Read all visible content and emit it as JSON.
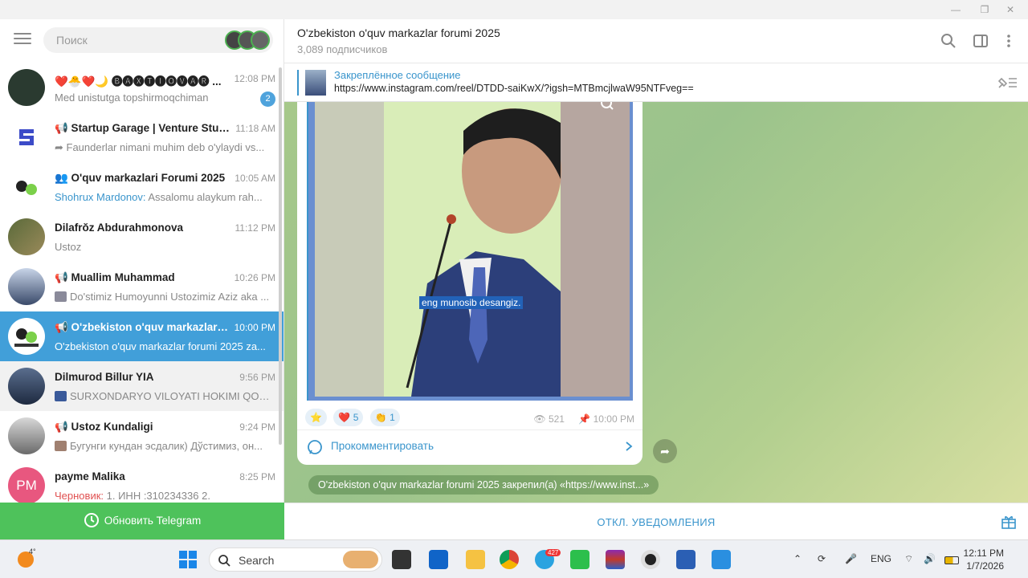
{
  "window": {
    "minimize": "—",
    "maximize": "❐",
    "close": "✕"
  },
  "sidebar": {
    "search_placeholder": "Поиск",
    "chats": [
      {
        "name": "❤️🐣❤️🌙 🅑🅐🅧🅣🅘🅞🅥🅐🅡 ...",
        "time": "12:08 PM",
        "preview": "Med unistutga topshirmoqchiman",
        "unread": "2"
      },
      {
        "name": "📢 Startup Garage | Venture Studi...",
        "time": "11:18 AM",
        "preview": "➦ Faunderlar nimani muhim deb o'ylaydi vs..."
      },
      {
        "name": "👥 O'quv markazlari Forumi 2025",
        "time": "10:05 AM",
        "sender": "Shohrux Mardonov:",
        "preview": " Assalomu alaykum rah..."
      },
      {
        "name": "Dilafrŏz Abdurahmonova",
        "time": "11:12 PM",
        "preview": "Ustoz"
      },
      {
        "name": "📢 Muallim Muhammad",
        "time": "10:26 PM",
        "preview": "Do'stimiz Humoyunni Ustozimiz Aziz aka ..."
      },
      {
        "name": "📢 O'zbekiston o'quv markazlar fo...",
        "time": "10:00 PM",
        "preview": "O'zbekiston o'quv markazlar forumi 2025 za..."
      },
      {
        "name": "Dilmurod Billur YIA",
        "time": "9:56 PM",
        "preview": "SURXONDARYO VILOYATI HOKIMI QOSIM..."
      },
      {
        "name": "📢 Ustoz Kundaligi",
        "time": "9:24 PM",
        "preview": "Бугунги кундан эсдалик)  Дўстимиз, он..."
      },
      {
        "name": "payme Malika",
        "time": "8:25 PM",
        "draft": "Черновик:",
        "preview": " 1. ИНН :310234336 2.",
        "initials": "PM"
      }
    ],
    "update_label": "Обновить Telegram"
  },
  "header": {
    "title": "O'zbekiston o'quv markazlar forumi 2025",
    "subscribers": "3,089 подписчиков"
  },
  "pinned": {
    "title": "Закреплённое сообщение",
    "text": "https://www.instagram.com/reel/DTDD-saiKwX/?igsh=MTBmcjlwaW95NTFveg=="
  },
  "post": {
    "caption": "eng munosib desangiz.",
    "reactions": [
      {
        "emoji": "⭐",
        "count": ""
      },
      {
        "emoji": "❤️",
        "count": "5"
      },
      {
        "emoji": "👏",
        "count": "1"
      }
    ],
    "views": "521",
    "time": "10:00 PM",
    "comment_label": "Прокомментировать"
  },
  "system_message": "O'zbekiston o'quv markazlar forumi 2025 закрепил(а) «https://www.inst...»",
  "mute_label": "ОТКЛ. УВЕДОМЛЕНИЯ",
  "taskbar": {
    "weather": "4°",
    "search_label": "Search",
    "telegram_badge": "427",
    "lang": "ENG",
    "time": "12:11 PM",
    "date": "1/7/2026"
  },
  "colors": {
    "accent": "#419fd9",
    "update_green": "#4ec25b",
    "chat_bg": "#a6c88a"
  }
}
